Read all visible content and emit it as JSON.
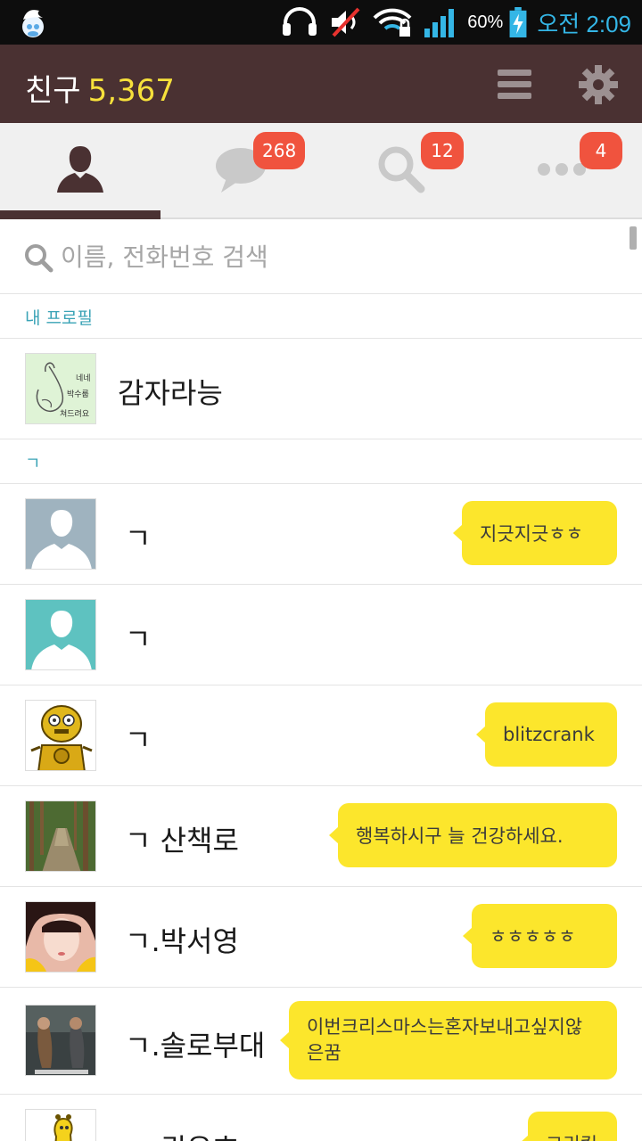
{
  "status_bar": {
    "battery_percent": "60%",
    "time": "오전 2:09",
    "icons": [
      "smurf-app-icon",
      "headphones-icon",
      "mute-icon",
      "wifi-lock-icon",
      "signal-icon",
      "battery-charging-icon"
    ]
  },
  "header": {
    "title": "친구",
    "friend_count": "5,367",
    "colors": {
      "bar": "#4a3132",
      "count": "#f7e13b"
    }
  },
  "tabs": [
    {
      "icon": "person-icon",
      "active": true
    },
    {
      "icon": "chat-bubble-icon",
      "badge": "268"
    },
    {
      "icon": "search-icon",
      "badge": "12"
    },
    {
      "icon": "more-dots-icon",
      "badge": "4"
    }
  ],
  "search": {
    "placeholder": "이름, 전화번호 검색"
  },
  "sections": {
    "my_profile": "내 프로필",
    "giyeok": "ㄱ"
  },
  "my_profile": {
    "name": "감자라능",
    "avatar_text": [
      "네네",
      "박수룹",
      "쳐드려요"
    ]
  },
  "friends": [
    {
      "name": "ㄱ",
      "status": "지긋지긋ㅎㅎ",
      "avatar": "default-gray"
    },
    {
      "name": "ㄱ",
      "status": "",
      "avatar": "default-teal"
    },
    {
      "name": "ㄱ",
      "status": "blitzcrank",
      "avatar": "robot"
    },
    {
      "name": "ㄱ 산책로",
      "status": "행복하시구 늘 건강하세요.",
      "avatar": "forest-path"
    },
    {
      "name": "ㄱ.박서영",
      "status": "ㅎㅎㅎㅎㅎ",
      "avatar": "girl"
    },
    {
      "name": "ㄱ.솔로부대",
      "status": "이번크리스마스는혼자보내고싶지않은꿈",
      "avatar": "game-cover"
    },
    {
      "name": "ㄱ.권유호",
      "status": "그리킹",
      "avatar": "giraffe"
    }
  ],
  "colors": {
    "bubble": "#fce62c",
    "badge": "#f0533e",
    "section_text": "#3aa3b6",
    "time": "#34b6e6"
  }
}
